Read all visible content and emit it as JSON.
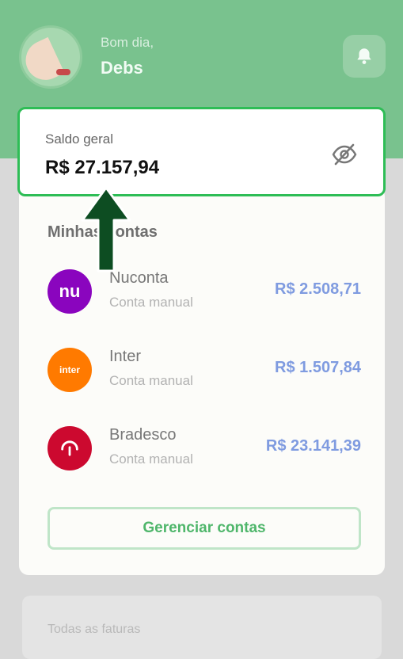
{
  "header": {
    "greeting": "Bom dia,",
    "user_name": "Debs",
    "notification_icon": "bell-icon"
  },
  "balance": {
    "label": "Saldo geral",
    "value": "R$ 27.157,94",
    "visibility_icon": "eye-off-icon"
  },
  "accounts": {
    "title": "Minhas contas",
    "items": [
      {
        "name": "Nuconta",
        "type": "Conta manual",
        "amount": "R$ 2.508,71",
        "logo_text": "nu",
        "color": "#8a05be"
      },
      {
        "name": "Inter",
        "type": "Conta manual",
        "amount": "R$ 1.507,84",
        "logo_text": "inter",
        "color": "#ff7a00"
      },
      {
        "name": "Bradesco",
        "type": "Conta manual",
        "amount": "R$ 23.141,39",
        "logo_text": "",
        "color": "#cc092f"
      }
    ],
    "manage_button": "Gerenciar contas"
  },
  "invoices": {
    "label": "Todas as faturas"
  },
  "colors": {
    "header_green": "#79c28e",
    "highlight_border": "#2ebd56",
    "arrow": "#0d4d22",
    "amount_blue": "#7f9be0"
  }
}
